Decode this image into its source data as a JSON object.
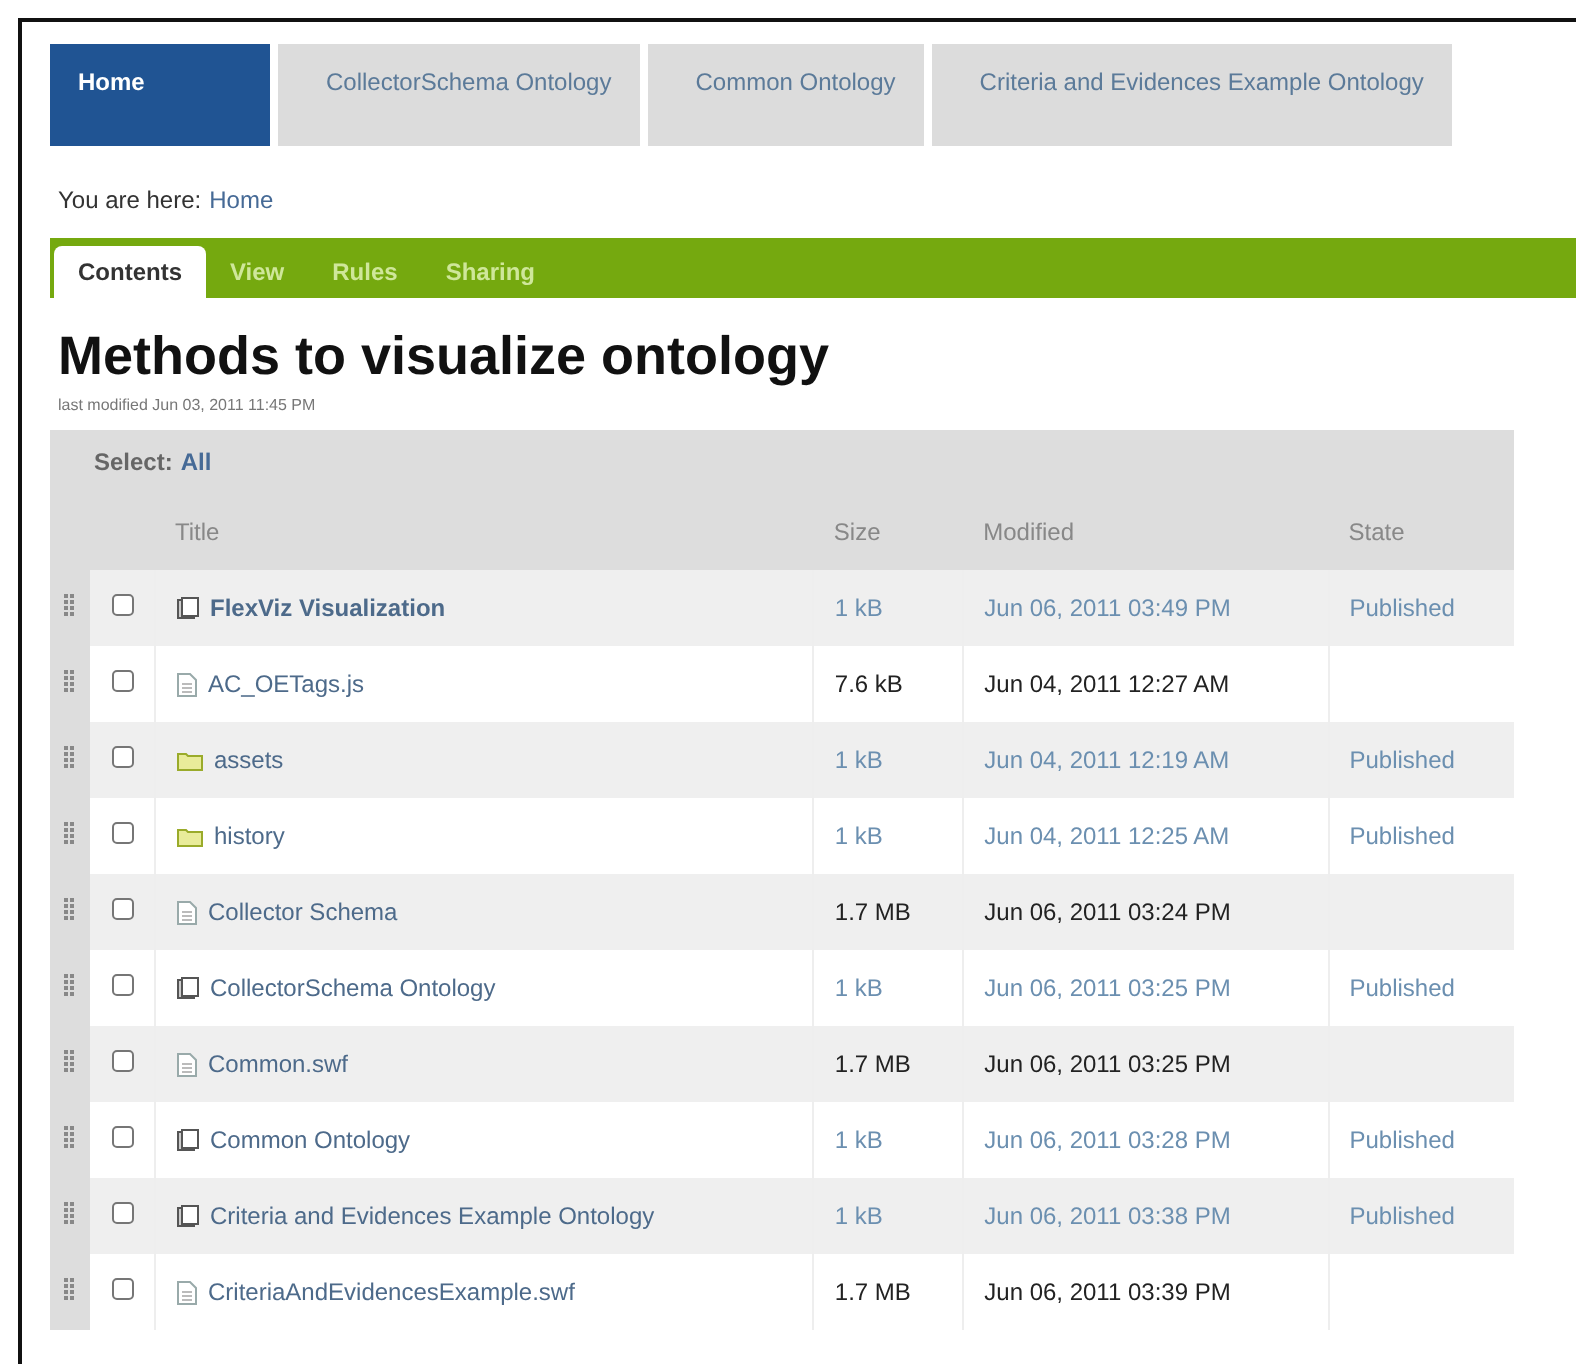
{
  "nav_tabs": [
    {
      "label": "Home",
      "selected": true
    },
    {
      "label": "CollectorSchema Ontology",
      "selected": false
    },
    {
      "label": "Common Ontology",
      "selected": false
    },
    {
      "label": "Criteria and Evidences Example Ontology",
      "selected": false
    }
  ],
  "breadcrumb": {
    "prefix": "You are here:",
    "link": "Home"
  },
  "content_tabs": [
    {
      "label": "Contents",
      "selected": true
    },
    {
      "label": "View",
      "selected": false
    },
    {
      "label": "Rules",
      "selected": false
    },
    {
      "label": "Sharing",
      "selected": false
    }
  ],
  "title": "Methods to visualize ontology",
  "last_modified": "last modified Jun 03, 2011 11:45 PM",
  "table": {
    "select": {
      "prefix": "Select:",
      "link": "All"
    },
    "columns": [
      "Title",
      "Size",
      "Modified",
      "State"
    ],
    "rows": [
      {
        "kind": "document",
        "title": "FlexViz Visualization",
        "bold": true,
        "size": "1 kB",
        "modified": "Jun 06, 2011 03:49 PM",
        "state": "Published",
        "checked": false
      },
      {
        "kind": "file",
        "title": "AC_OETags.js",
        "bold": false,
        "size": "7.6 kB",
        "modified": "Jun 04, 2011 12:27 AM",
        "checked": false
      },
      {
        "kind": "folder",
        "title": "assets",
        "bold": false,
        "size": "1 kB",
        "modified": "Jun 04, 2011 12:19 AM",
        "state": "Published",
        "checked": false
      },
      {
        "kind": "folder",
        "title": "history",
        "bold": false,
        "size": "1 kB",
        "modified": "Jun 04, 2011 12:25 AM",
        "state": "Published",
        "checked": false
      },
      {
        "kind": "file",
        "title": "Collector Schema",
        "bold": false,
        "size": "1.7 MB",
        "modified": "Jun 06, 2011 03:24 PM",
        "checked": false
      },
      {
        "kind": "document",
        "title": "CollectorSchema Ontology",
        "bold": false,
        "size": "1 kB",
        "modified": "Jun 06, 2011 03:25 PM",
        "state": "Published",
        "checked": false
      },
      {
        "kind": "file",
        "title": "Common.swf",
        "bold": false,
        "size": "1.7 MB",
        "modified": "Jun 06, 2011 03:25 PM",
        "checked": false
      },
      {
        "kind": "document",
        "title": "Common Ontology",
        "bold": false,
        "size": "1 kB",
        "modified": "Jun 06, 2011 03:28 PM",
        "state": "Published",
        "checked": false
      },
      {
        "kind": "document",
        "title": "Criteria and Evidences Example Ontology",
        "bold": false,
        "size": "1 kB",
        "modified": "Jun 06, 2011 03:38 PM",
        "state": "Published",
        "checked": false
      },
      {
        "kind": "file",
        "title": "CriteriaAndEvidencesExample.swf",
        "bold": false,
        "size": "1.7 MB",
        "modified": "Jun 06, 2011 03:39 PM",
        "checked": false
      }
    ]
  }
}
